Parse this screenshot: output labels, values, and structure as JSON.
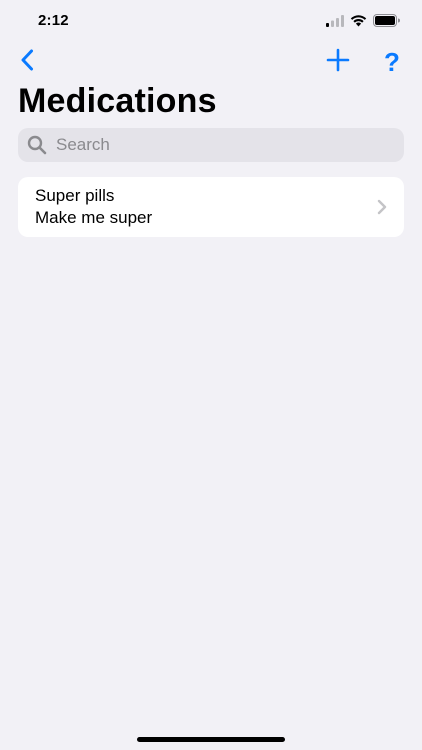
{
  "status_bar": {
    "time": "2:12"
  },
  "nav": {
    "back_icon": "chevron-left-icon",
    "add_icon": "plus-icon",
    "help_label": "?"
  },
  "page": {
    "title": "Medications"
  },
  "search": {
    "placeholder": "Search",
    "value": ""
  },
  "medications": [
    {
      "name": "Super pills",
      "description": "Make me super"
    }
  ],
  "colors": {
    "accent": "#0a7aff",
    "background": "#f2f1f6",
    "card": "#ffffff",
    "search_field": "#e4e3e9",
    "placeholder": "#8a8a8e",
    "chevron": "#c4c4c7"
  }
}
